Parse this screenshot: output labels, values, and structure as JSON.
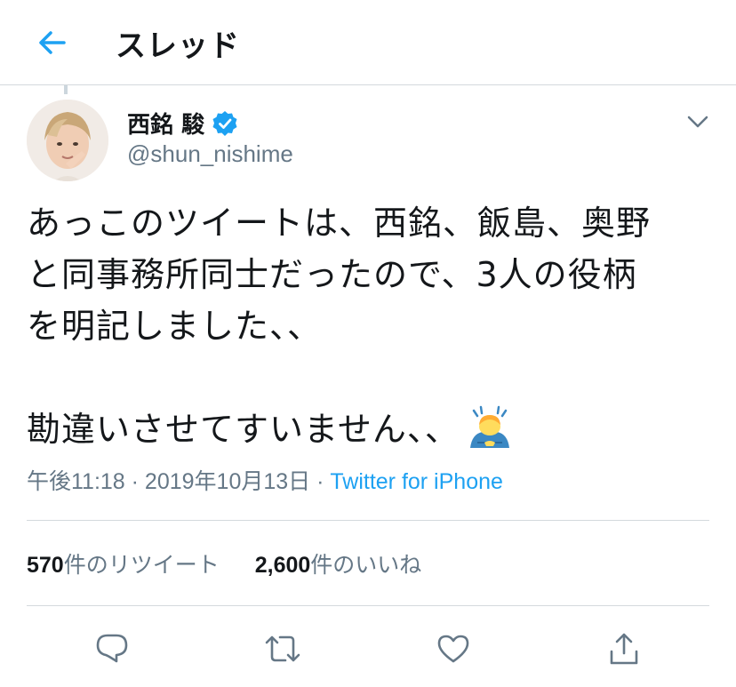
{
  "header": {
    "title": "スレッド",
    "back_icon": "back-arrow-icon"
  },
  "tweet": {
    "author_name": "西銘 駿",
    "verified": true,
    "handle": "@shun_nishime",
    "lines": [
      "あっこのツイートは、西銘、飯島、奥野",
      "と同事務所同士だったので、3人の役柄",
      "を明記しました、、",
      "",
      "勘違いさせてすいません、、"
    ],
    "emoji": "man-bowing-emoji",
    "time": "午後11:18 · 2019年10月13日 · ",
    "source": "Twitter for iPhone"
  },
  "stats": {
    "retweets_count": "570",
    "retweets_label": "件のリツイート",
    "likes_count": "2,600",
    "likes_label": "件のいいね"
  },
  "colors": {
    "accent": "#1da1f2",
    "muted": "#657786",
    "text": "#14171a",
    "divider": "#d4d9dd"
  }
}
